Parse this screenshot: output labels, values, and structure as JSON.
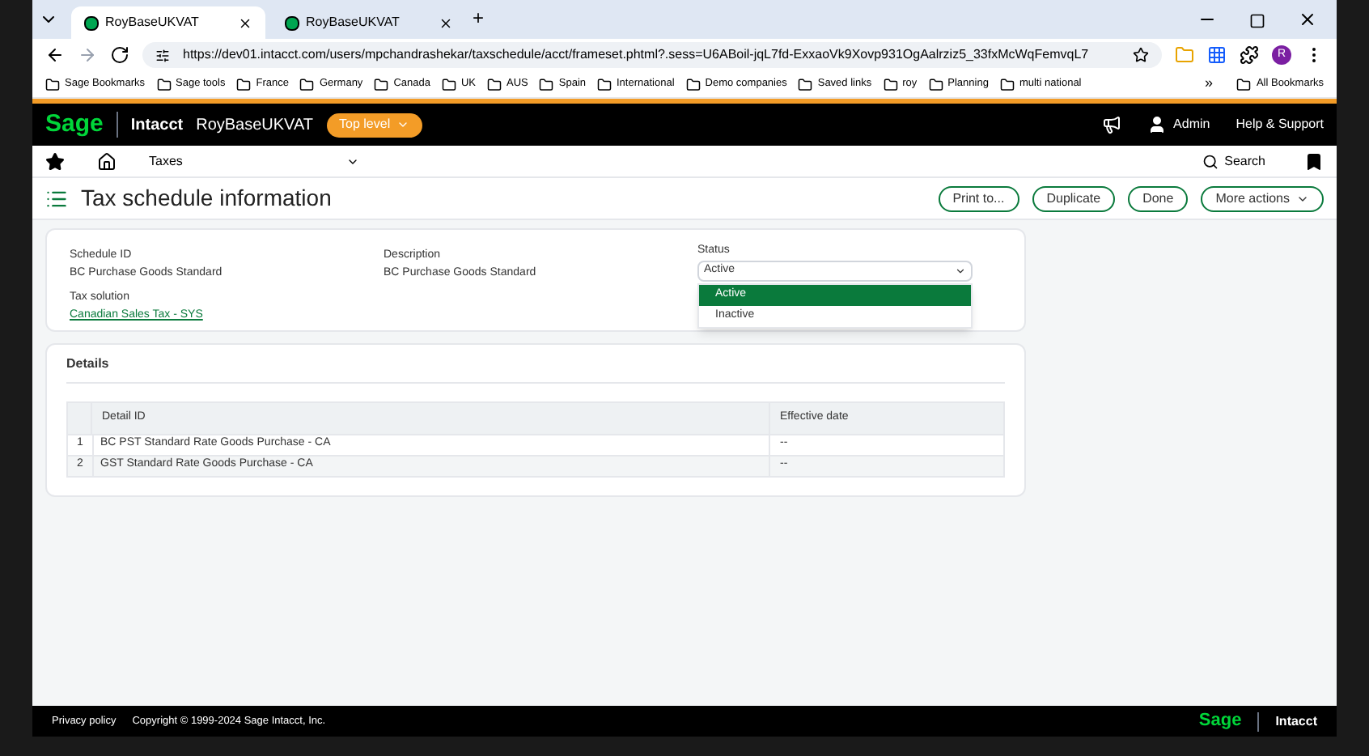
{
  "browser": {
    "tabs": [
      {
        "title": "RoyBaseUKVAT",
        "selected": true
      },
      {
        "title": "RoyBaseUKVAT",
        "selected": false
      }
    ],
    "new_tab": "+",
    "url": "https://dev01.intacct.com/users/mpchandrashekar/taxschedule/acct/frameset.phtml?.sess=U6ABoil-jqL7fd-ExxaoVk9Xovp931OgAalrziz5_33fxMcWqFemvqL7",
    "avatar": "R",
    "bookmarks": [
      "Sage Bookmarks",
      "Sage tools",
      "France",
      "Germany",
      "Canada",
      "UK",
      "AUS",
      "Spain",
      "International",
      "Demo companies",
      "Saved links",
      "roy",
      "Planning",
      "multi national"
    ],
    "more": "»",
    "all_bookmarks": "All Bookmarks"
  },
  "app": {
    "logo": "Sage",
    "product": "Intacct",
    "company": "RoyBaseUKVAT",
    "level": "Top level",
    "user": "Admin",
    "help": "Help & Support",
    "module": "Taxes",
    "search": "Search"
  },
  "page": {
    "title": "Tax schedule information",
    "actions": [
      {
        "label": "Print to...",
        "kind": "button"
      },
      {
        "label": "Duplicate",
        "kind": "button"
      },
      {
        "label": "Done",
        "kind": "button"
      },
      {
        "label": "More actions",
        "kind": "menu"
      }
    ]
  },
  "form": {
    "schedule_id": {
      "label": "Schedule ID",
      "value": "BC Purchase Goods Standard"
    },
    "description": {
      "label": "Description",
      "value": "BC Purchase Goods Standard"
    },
    "tax_solution": {
      "label": "Tax solution",
      "value": "Canadian Sales Tax - SYS"
    },
    "status": {
      "label": "Status",
      "value": "Active",
      "expanded": true,
      "options": [
        {
          "label": "Active",
          "selected": true
        },
        {
          "label": "Inactive",
          "selected": false
        }
      ]
    }
  },
  "details": {
    "title": "Details",
    "columns": [
      "Detail ID",
      "Effective date"
    ],
    "rows": [
      {
        "n": "1",
        "detail_id": "BC PST Standard Rate Goods Purchase - CA",
        "effective_date": "--"
      },
      {
        "n": "2",
        "detail_id": "GST Standard Rate Goods Purchase - CA",
        "effective_date": "--"
      }
    ]
  },
  "footer": {
    "links": [
      "Privacy policy"
    ],
    "copyright": "Copyright © 1999-2024 Sage Intacct, Inc.",
    "logo": "Sage",
    "product": "Intacct"
  }
}
